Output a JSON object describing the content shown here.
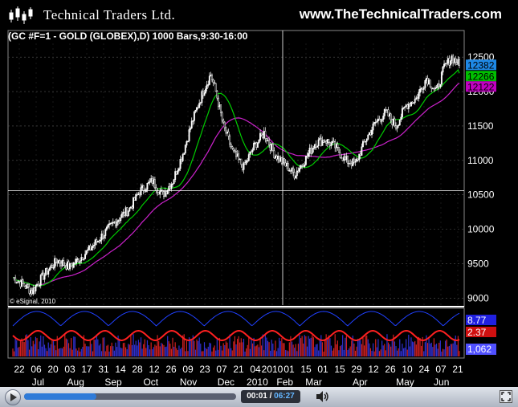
{
  "header": {
    "logo_text": "Technical Traders Ltd.",
    "site_url": "www.TheTechnicalTraders.com"
  },
  "chart": {
    "title": "(GC #F=1 - GOLD (GLOBEX),D) 1000 Bars,9:30-16:00",
    "copyright": "© eSignal, 2010"
  },
  "player": {
    "time_current": "00:01",
    "separator": "/",
    "time_total": "06:27",
    "progress_percent": 34
  },
  "colors": {
    "background": "#000000",
    "candle": "#ffffff",
    "ma_fast": "#00cc00",
    "ma_slow": "#cc22cc",
    "grid": "#555555",
    "crosshair": "#ffffff",
    "last_price_box": "#1e88e5",
    "fast_box": "#00c000",
    "slow_box": "#c000c0",
    "osc_red": "#ff2020",
    "osc_blue": "#2040ff",
    "volume_box": "#5050ff"
  },
  "chart_data": {
    "type": "candlestick",
    "title": "(GC #F=1 - GOLD (GLOBEX),D) 1000 Bars,9:30-16:00",
    "ylim": [
      8900,
      12700
    ],
    "y_ticks": [
      9000,
      9500,
      10000,
      10500,
      11000,
      11500,
      12000,
      12500
    ],
    "x_tick_labels": [
      "22",
      "06",
      "20",
      "03",
      "17",
      "31",
      "14",
      "28",
      "12",
      "26",
      "09",
      "23",
      "07",
      "21",
      "04",
      "2010",
      "01",
      "15",
      "01",
      "15",
      "29",
      "12",
      "26",
      "10",
      "24",
      "07",
      "21"
    ],
    "x_month_labels": [
      "Jul",
      "Aug",
      "Sep",
      "Oct",
      "Nov",
      "Dec",
      "2010",
      "Feb",
      "Mar",
      "Apr",
      "May",
      "Jun"
    ],
    "price_path": [
      [
        0,
        9300
      ],
      [
        8,
        9200
      ],
      [
        15,
        9100
      ],
      [
        25,
        9350
      ],
      [
        35,
        9550
      ],
      [
        45,
        9450
      ],
      [
        60,
        9700
      ],
      [
        70,
        9900
      ],
      [
        80,
        10100
      ],
      [
        92,
        10300
      ],
      [
        100,
        10550
      ],
      [
        110,
        10700
      ],
      [
        118,
        10500
      ],
      [
        126,
        10700
      ],
      [
        134,
        11100
      ],
      [
        142,
        11600
      ],
      [
        150,
        12000
      ],
      [
        156,
        12250
      ],
      [
        160,
        12000
      ],
      [
        166,
        11500
      ],
      [
        174,
        11100
      ],
      [
        182,
        10900
      ],
      [
        190,
        11200
      ],
      [
        198,
        11400
      ],
      [
        206,
        11100
      ],
      [
        214,
        10950
      ],
      [
        222,
        10800
      ],
      [
        230,
        11000
      ],
      [
        238,
        11250
      ],
      [
        246,
        11300
      ],
      [
        254,
        11200
      ],
      [
        262,
        11000
      ],
      [
        270,
        10950
      ],
      [
        278,
        11300
      ],
      [
        286,
        11550
      ],
      [
        294,
        11700
      ],
      [
        302,
        11500
      ],
      [
        310,
        11800
      ],
      [
        318,
        11900
      ],
      [
        326,
        12200
      ],
      [
        334,
        12000
      ],
      [
        340,
        12350
      ],
      [
        346,
        12500
      ],
      [
        352,
        12383
      ]
    ],
    "last_price": "12382",
    "ma_fast_value": "12266",
    "ma_slow_value": "12122",
    "oscillator_value": "2.37",
    "oscillator_top_value": "8.77",
    "volume_value": "1,062"
  }
}
